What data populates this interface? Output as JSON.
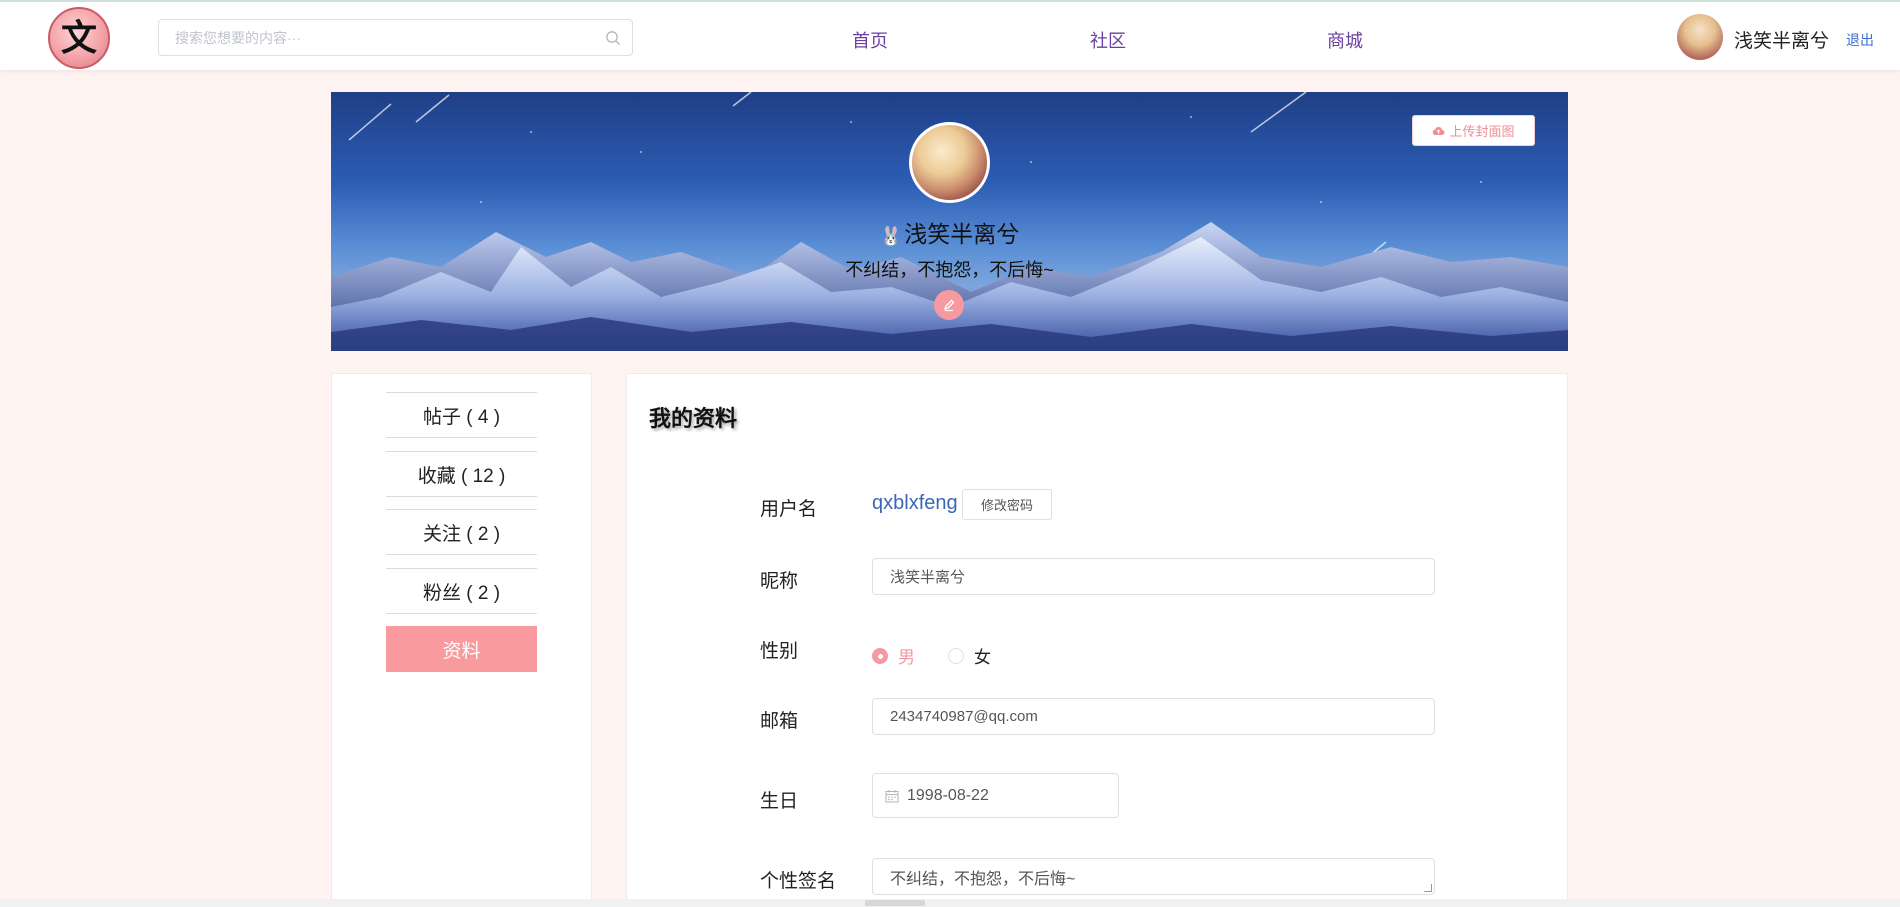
{
  "header": {
    "logo_text": "文",
    "search_placeholder": "搜索您想要的内容···",
    "nav": [
      "首页",
      "社区",
      "商城"
    ],
    "user_name": "浅笑半离兮",
    "logout": "退出"
  },
  "banner": {
    "upload_label": "上传封面图",
    "name": "浅笑半离兮",
    "signature": "不纠结，不抱怨，不后悔~"
  },
  "sidebar": {
    "items": [
      {
        "label": "帖子 ( 4 )"
      },
      {
        "label": "收藏 ( 12 )"
      },
      {
        "label": "关注 ( 2 )"
      },
      {
        "label": "粉丝 ( 2 )"
      },
      {
        "label": "资料"
      }
    ],
    "active_index": 4
  },
  "profile": {
    "title": "我的资料",
    "username_label": "用户名",
    "username": "qxblxfeng",
    "change_password": "修改密码",
    "nickname_label": "昵称",
    "nickname": "浅笑半离兮",
    "gender_label": "性别",
    "gender_options": [
      "男",
      "女"
    ],
    "gender_selected": "男",
    "email_label": "邮箱",
    "email": "2434740987@qq.com",
    "birthday_label": "生日",
    "birthday": "1998-08-22",
    "signature_label": "个性签名",
    "signature": "不纠结，不抱怨，不后悔~"
  },
  "colors": {
    "accent": "#f99a9e",
    "nav": "#6b3fa0",
    "link": "#3a67b5",
    "page_bg": "#fff3f2"
  }
}
